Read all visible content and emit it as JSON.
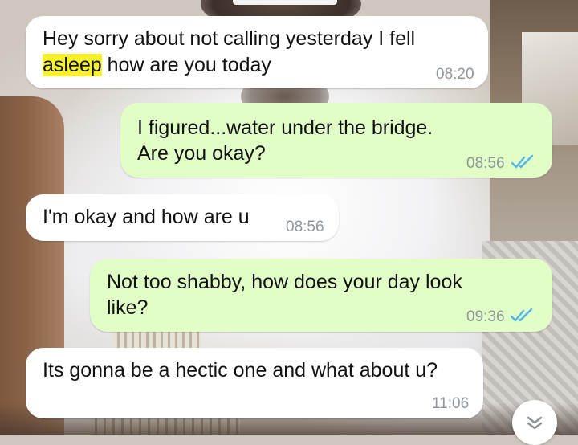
{
  "chat": {
    "messages": [
      {
        "direction": "incoming",
        "line1": "Hey sorry about not calling yesterday I fell",
        "line2_highlight": "asleep",
        "line2_rest": " how are you today",
        "time": "08:20"
      },
      {
        "direction": "outgoing",
        "line1": "I figured...water under the bridge.",
        "line2": "Are you okay?",
        "time": "08:56",
        "status": "read"
      },
      {
        "direction": "incoming",
        "line1": "I'm okay and how are u",
        "time": "08:56"
      },
      {
        "direction": "outgoing",
        "line1": "Not too shabby, how does your day look",
        "line2": "like?",
        "time": "09:36",
        "status": "read"
      },
      {
        "direction": "incoming",
        "line1": "Its gonna be a hectic one and what about u?",
        "time": "11:06"
      }
    ]
  },
  "icons": {
    "read_receipt": "double-check-icon",
    "scroll_down": "chevrons-down-icon"
  },
  "colors": {
    "incoming_bubble": "#ffffff",
    "outgoing_bubble": "#e1fec6",
    "read_tick": "#4fb6ec",
    "timestamp": "#8f969b",
    "search_highlight": "#f6f12b"
  }
}
